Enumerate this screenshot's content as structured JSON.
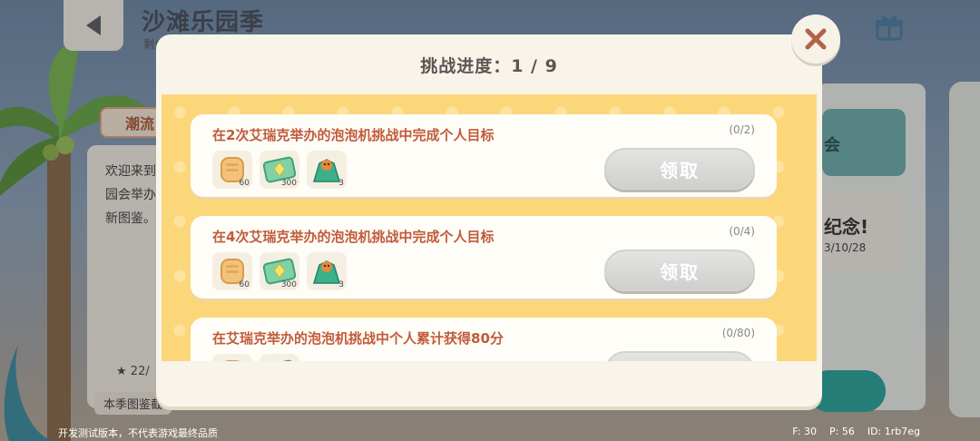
{
  "background": {
    "title": "沙滩乐园季",
    "subtitle": "剩余",
    "left_tag": "潮流",
    "left_text": "欢迎来到 园会举办 新图鉴。",
    "left_count": "22/",
    "left_footer": "本季图鉴截",
    "right_card_a": "会",
    "right_card_b_title": "纪念!",
    "right_card_b_date": "3/10/28"
  },
  "modal": {
    "title": "挑战进度：1 / 9",
    "claim_label": "领取",
    "tasks": [
      {
        "description": "在2次艾瑞克举办的泡泡机挑战中完成个人目标",
        "progress": "(0/2)",
        "rewards": [
          {
            "icon": "bread-icon",
            "qty": "60"
          },
          {
            "icon": "green-gem-ticket-icon",
            "qty": "300"
          },
          {
            "icon": "leaf-bundle-icon",
            "qty": "3"
          }
        ]
      },
      {
        "description": "在4次艾瑞克举办的泡泡机挑战中完成个人目标",
        "progress": "(0/4)",
        "rewards": [
          {
            "icon": "bread-icon",
            "qty": "60"
          },
          {
            "icon": "green-gem-ticket-icon",
            "qty": "300"
          },
          {
            "icon": "leaf-bundle-icon",
            "qty": "3"
          }
        ]
      },
      {
        "description": "在艾瑞克举办的泡泡机挑战中个人累计获得80分",
        "progress": "(0/80)",
        "rewards": [
          {
            "icon": "bread-icon",
            "qty": ""
          },
          {
            "icon": "green-gem-ticket-icon",
            "qty": ""
          }
        ]
      }
    ]
  },
  "footer": {
    "dev_note": "开发测试版本，不代表游戏最终品质",
    "fps": "F: 30",
    "ping": "P: 56",
    "id": "ID: 1rb7eg"
  }
}
